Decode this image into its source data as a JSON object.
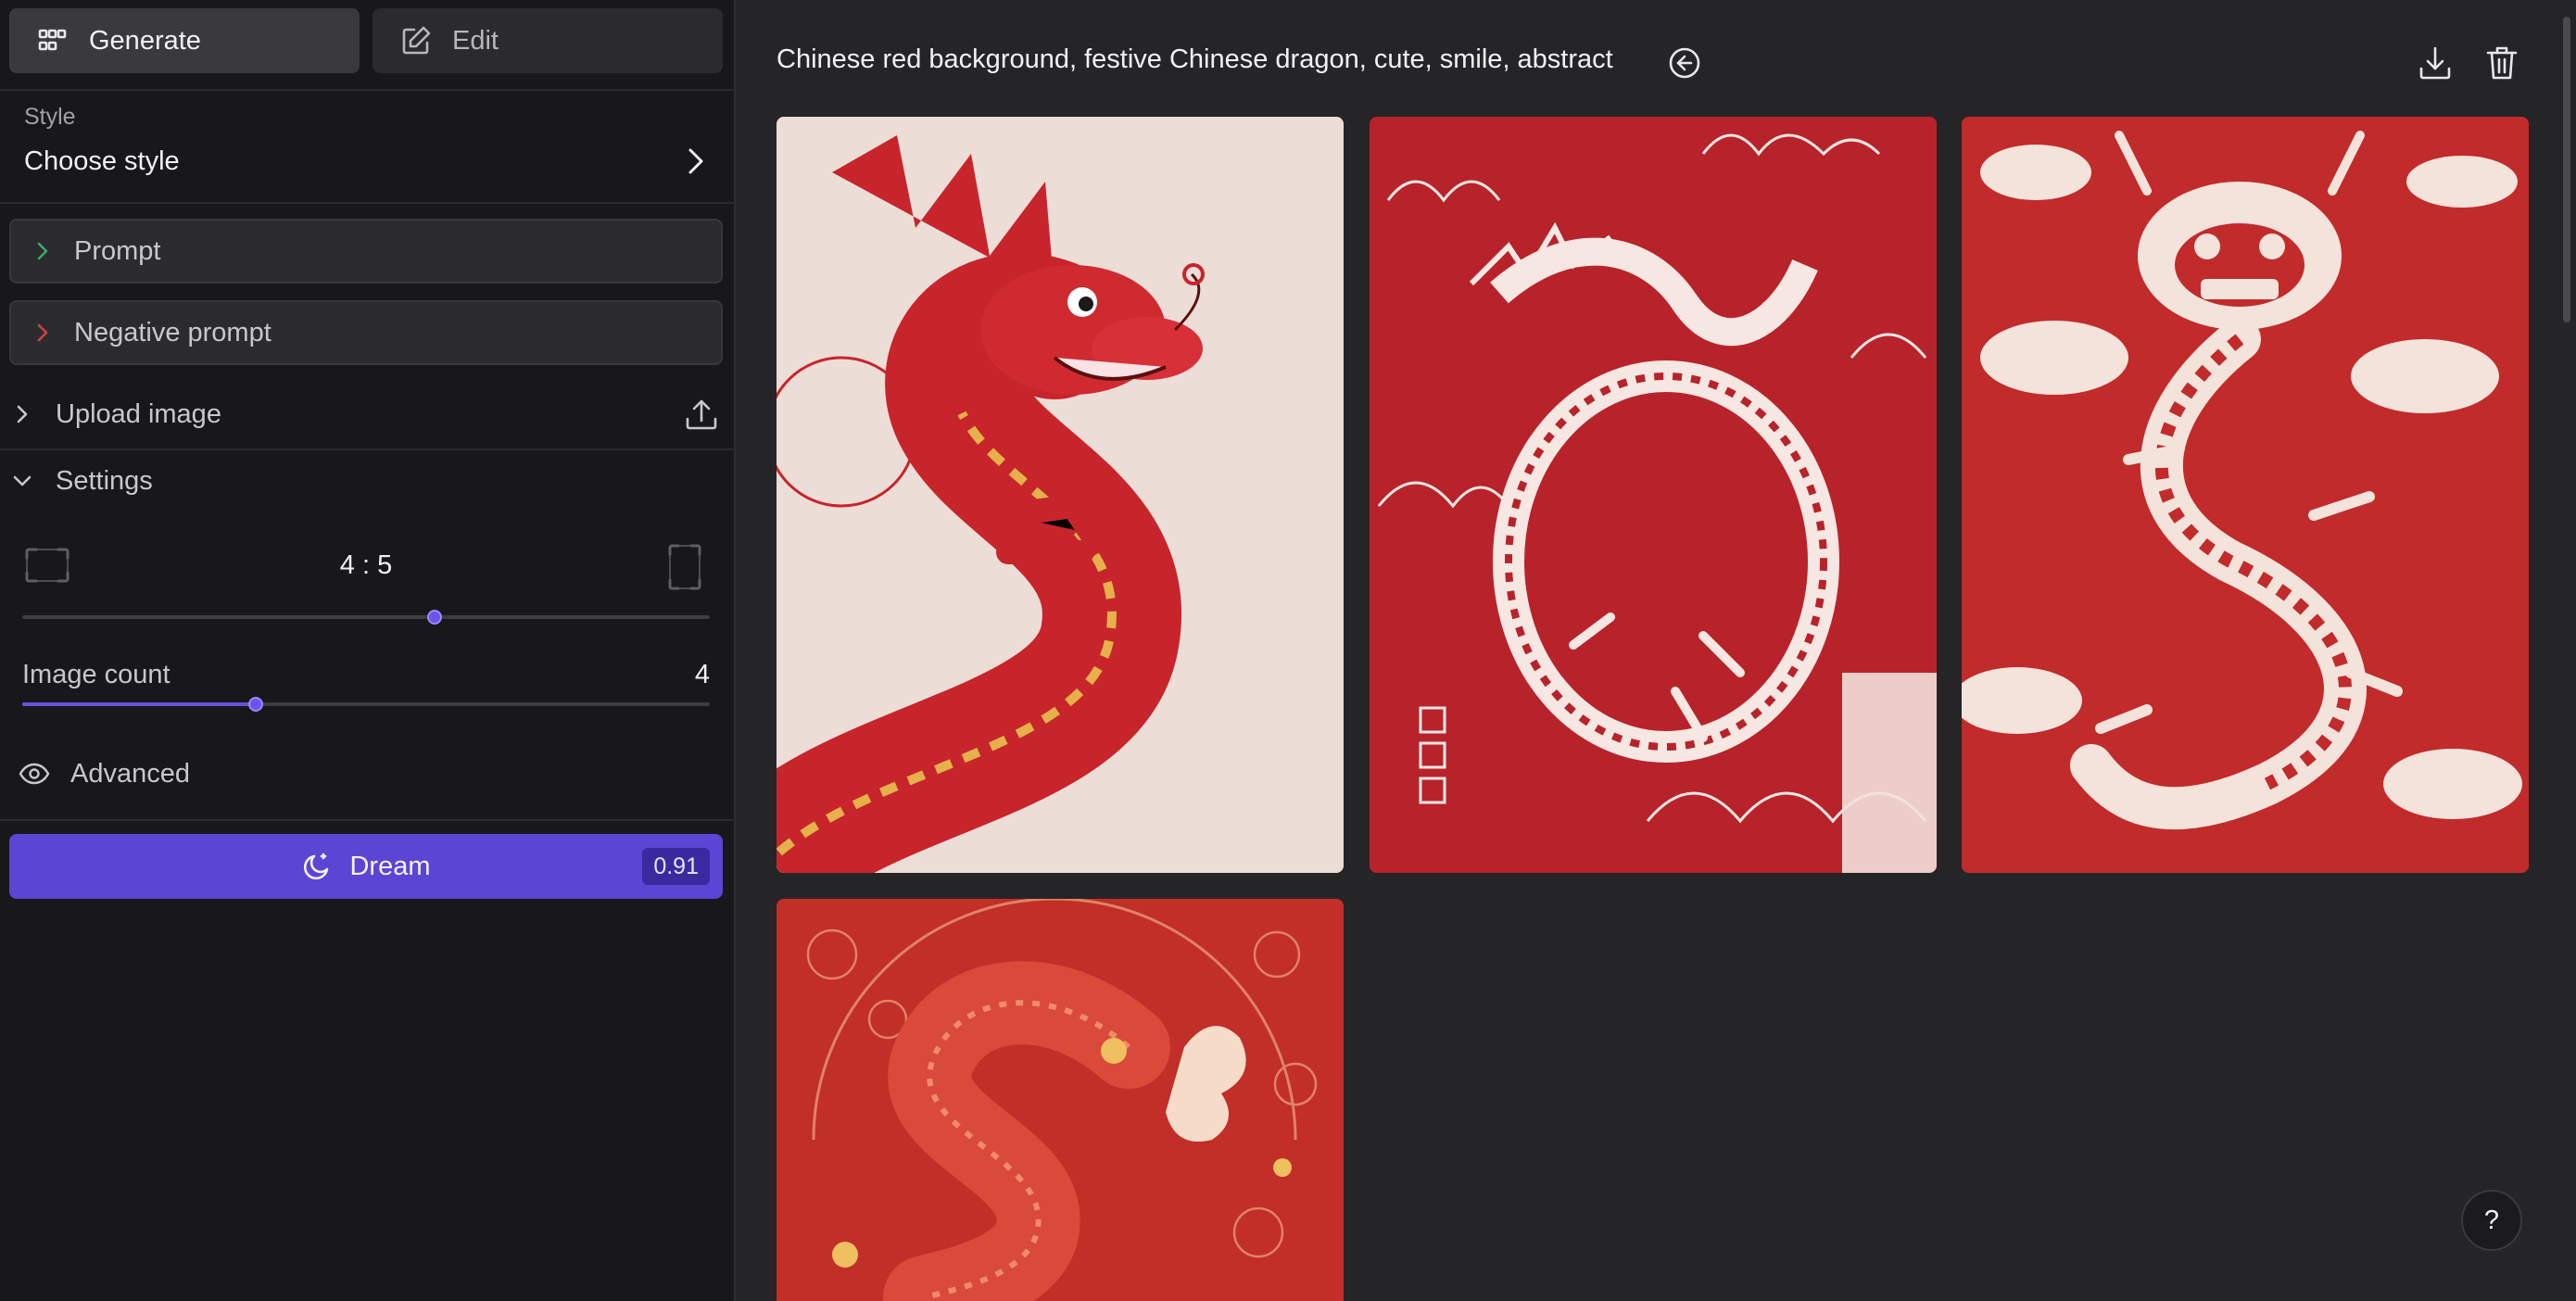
{
  "sidebar": {
    "modes": {
      "generate": "Generate",
      "edit": "Edit"
    },
    "style": {
      "label": "Style",
      "value": "Choose style"
    },
    "prompt_label": "Prompt",
    "negative_prompt_label": "Negative prompt",
    "upload_label": "Upload image",
    "settings": {
      "label": "Settings",
      "aspect_ratio": "4 : 5",
      "aspect_slider_level": 0.6,
      "image_count_label": "Image count",
      "image_count_value": "4",
      "image_count_level": 0.34
    },
    "advanced_label": "Advanced",
    "dream": {
      "label": "Dream",
      "credits": "0.91"
    }
  },
  "main": {
    "prompt_text": "Chinese red background, festive Chinese dragon, cute, smile, abstract",
    "images_count": 4
  },
  "help_label": "?",
  "colors": {
    "accent": "#5b45d4",
    "background": "#252527",
    "sidebar": "#18181a"
  },
  "icons": [
    "grid-icon",
    "pencil-icon",
    "chevron-right-icon",
    "chevron-down-icon",
    "upload-icon",
    "landscape-frame-icon",
    "portrait-frame-icon",
    "eye-icon",
    "moon-icon",
    "back-circle-icon",
    "download-icon",
    "trash-icon"
  ]
}
